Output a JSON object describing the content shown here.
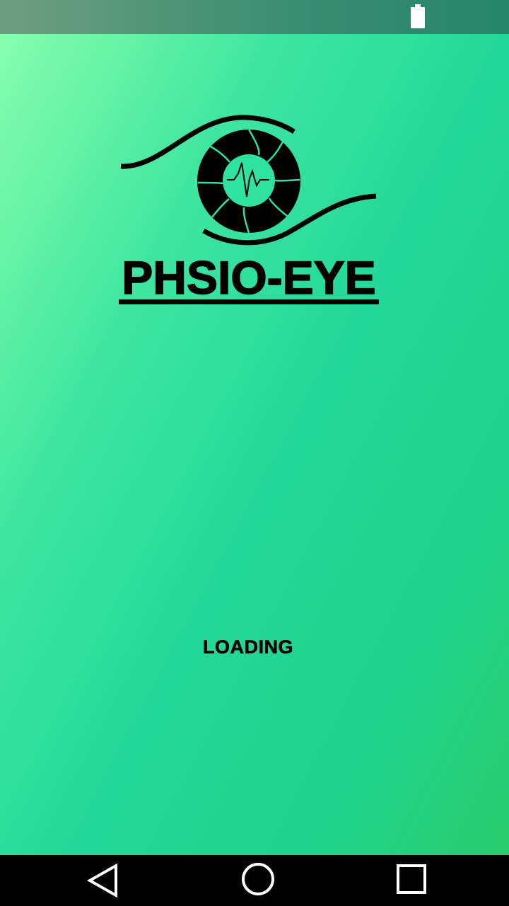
{
  "app": {
    "title": "PHSIO-EYE",
    "logo_icon": "eye-heartbeat-logo-icon"
  },
  "splash": {
    "loading_label": "LOADING"
  },
  "status_bar": {
    "battery_icon": "battery-full-icon"
  },
  "navigation_bar": {
    "back_icon": "back-triangle-icon",
    "home_icon": "home-circle-icon",
    "recents_icon": "recents-square-icon"
  },
  "colors": {
    "background_gradient": [
      "#8cffb0",
      "#3fe6a0",
      "#22d89a",
      "#2acb6c"
    ],
    "text": "#000000",
    "nav_bar": "#000000",
    "status_bar": "#3f8f74"
  }
}
